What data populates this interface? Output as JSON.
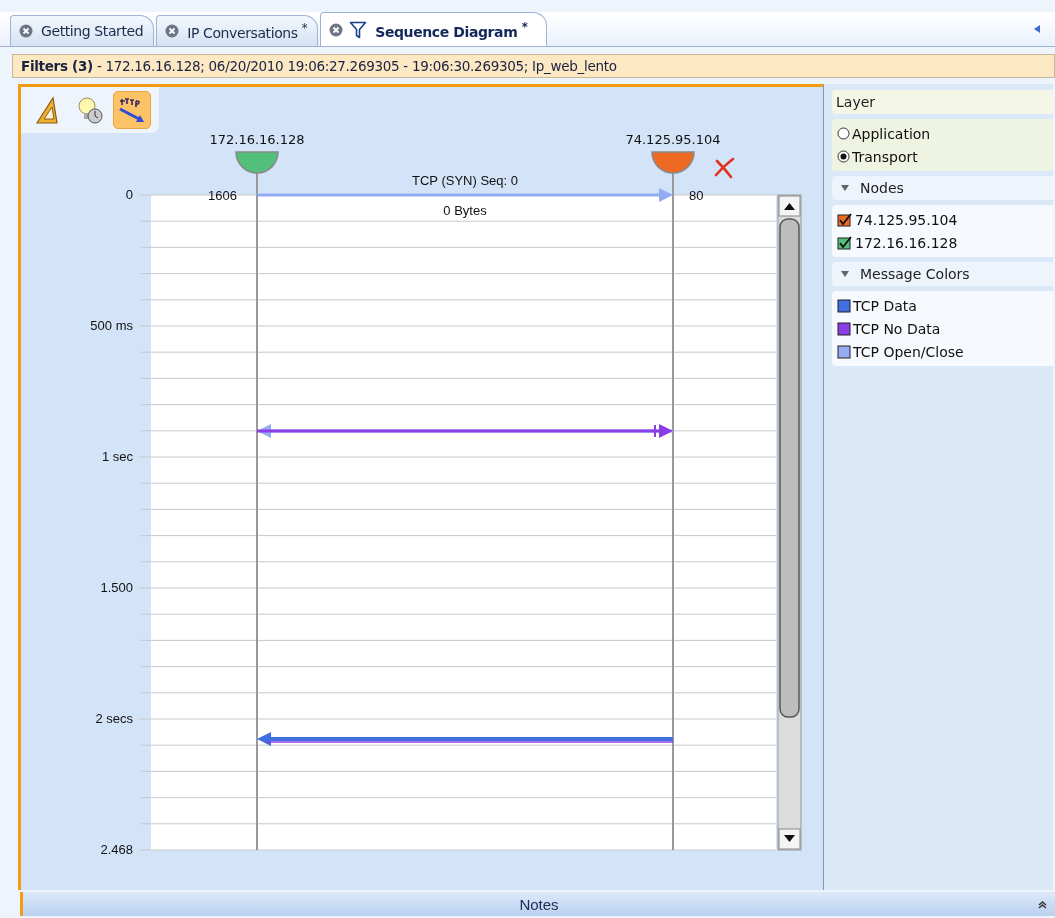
{
  "tabs": [
    {
      "label": "Getting Started",
      "filtered": false,
      "selected": false
    },
    {
      "label": "IP Conversations $^{*}$",
      "filtered": false,
      "selected": false
    },
    {
      "label": "Sequence Diagram $^{*}$",
      "filtered": true,
      "selected": true
    }
  ],
  "filter_bar": {
    "text": "**Filters (3)** - 172.16.16.128;  06/20/2010 19:06:27.269305 - 19:06:30.269305;  Ip_web_lento"
  },
  "toolbar": [
    {
      "kind": "ruler",
      "selected": false
    },
    {
      "kind": "bulb",
      "selected": false
    },
    {
      "kind": "http",
      "selected": true
    }
  ],
  "diagram": {
    "nodes": [
      {
        "label": "172.16.16.128",
        "port": "1606",
        "color": "#52c07a",
        "removable": false
      },
      {
        "label": "74.125.95.104",
        "port": "80",
        "color": "#ee6a24",
        "removable": true
      }
    ],
    "time_ticks": [
      "0",
      "500 ms",
      "1 sec",
      "1.500",
      "2 secs",
      "2.468"
    ],
    "messages": [
      {
        "kind": "open_close",
        "label": "TCP (SYN) Seq: 0",
        "sublabel": "0 Bytes"
      },
      {
        "kind": "no_data"
      },
      {
        "kind": "data"
      }
    ]
  },
  "side_panel": {
    "layer": {
      "title": "Layer",
      "options": [
        {
          "label": "Application",
          "selected": false
        },
        {
          "label": "Transport",
          "selected": true
        }
      ]
    },
    "nodes": {
      "title": "Nodes",
      "expanded": true,
      "items": [
        {
          "label": "74.125.95.104",
          "color": "#ee6a24",
          "checked": true
        },
        {
          "label": "172.16.16.128",
          "color": "#52c07a",
          "checked": true
        }
      ]
    },
    "message_colors": {
      "title": "Message Colors",
      "expanded": true,
      "items": [
        {
          "label": "TCP Data",
          "color": "#3f6fe0"
        },
        {
          "label": "TCP No Data",
          "color": "#8b3ee6"
        },
        {
          "label": "TCP Open/Close",
          "color": "#93abf2"
        }
      ]
    }
  },
  "notes_bar": {
    "title": "Notes"
  }
}
